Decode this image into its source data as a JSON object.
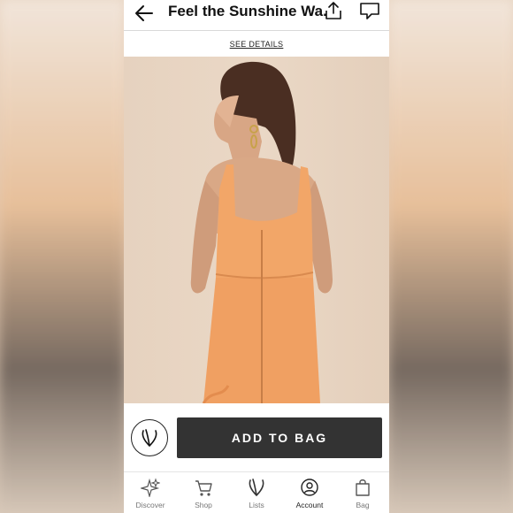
{
  "header": {
    "title": "Feel the Sunshine Wa..",
    "back_icon": "arrow-left-icon",
    "share_icon": "share-icon",
    "chat_icon": "chat-bubble-icon"
  },
  "details_link": "SEE DETAILS",
  "product_image": {
    "subject": "woman-in-orange-dress-back-view"
  },
  "actions": {
    "favorite_icon": "heart-icon",
    "add_to_bag_label": "ADD TO BAG"
  },
  "tabs": [
    {
      "label": "Discover",
      "icon": "sparkle-icon"
    },
    {
      "label": "Shop",
      "icon": "cart-icon"
    },
    {
      "label": "Lists",
      "icon": "heart-icon"
    },
    {
      "label": "Account",
      "icon": "user-icon"
    },
    {
      "label": "Bag",
      "icon": "bag-icon"
    }
  ],
  "colors": {
    "button_bg": "#333333",
    "dress": "#f2a668",
    "background": "#e9d7c6"
  }
}
